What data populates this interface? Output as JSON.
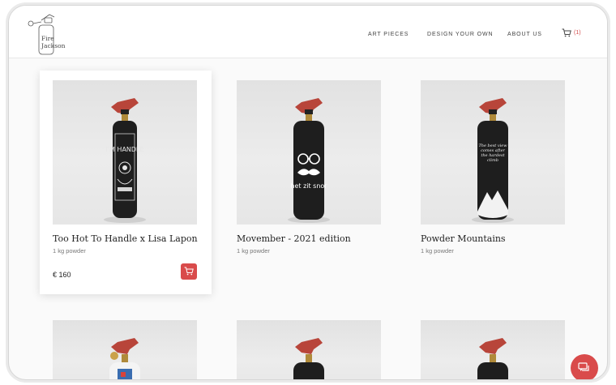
{
  "brand": {
    "line1": "Fire",
    "line2": "Jackson"
  },
  "nav": {
    "art_pieces": "ART PIECES",
    "design": "DESIGN YOUR OWN",
    "about": "ABOUT US"
  },
  "cart": {
    "count": "(1)"
  },
  "products": [
    {
      "title": "Too Hot To Handle x Lisa Lapon",
      "subtitle": "1 kg powder",
      "price": "€ 160",
      "art_text": "I'M HANDLE"
    },
    {
      "title": "Movember - 2021 edition",
      "subtitle": "1 kg powder",
      "art_text": "het zit snor"
    },
    {
      "title": "Powder Mountains",
      "subtitle": "1 kg powder",
      "art_text": "The best view comes after the hardest climb"
    }
  ],
  "colors": {
    "accent": "#d94b4b",
    "extinguisher_body": "#1e1e1e",
    "handle": "#b8453a"
  }
}
